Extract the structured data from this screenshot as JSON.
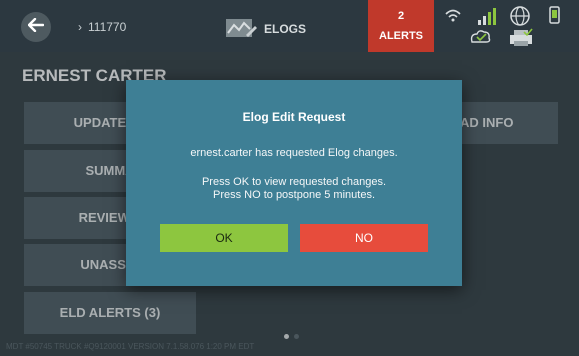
{
  "header": {
    "truck_id": "111770",
    "elogs_label": "ELOGS",
    "alerts_count": "2",
    "alerts_label": "ALERTS"
  },
  "driver": {
    "name": "ERNEST CARTER"
  },
  "menu": {
    "update_status": "UPDATE ST",
    "summary": "SUMMA",
    "review": "REVIEW L",
    "unassigned": "UNASSIG",
    "eld_alerts": "ELD ALERTS (3)",
    "load_info": "AD INFO"
  },
  "footer": {
    "text": "MDT #50745   TRUCK #Q9120001   VERSION 7.1.58.076   1:20 PM EDT"
  },
  "dialog": {
    "title": "Elog Edit Request",
    "message": "ernest.carter has requested Elog changes.",
    "line1": "Press OK to view requested changes.",
    "line2": "Press NO to postpone 5 minutes.",
    "ok_label": "OK",
    "no_label": "NO"
  },
  "colors": {
    "dialog_bg": "#3e7f95",
    "ok_button": "#8dc63f",
    "no_button": "#e74c3c",
    "alerts_bg": "#c0392b"
  },
  "icons": [
    "back-arrow-icon",
    "chevron-right-icon",
    "elogs-icon",
    "wifi-icon",
    "signal-icon",
    "globe-icon",
    "device-icon",
    "cloud-icon",
    "printer-icon"
  ],
  "page_indicator": {
    "pages": 2,
    "current": 1
  }
}
